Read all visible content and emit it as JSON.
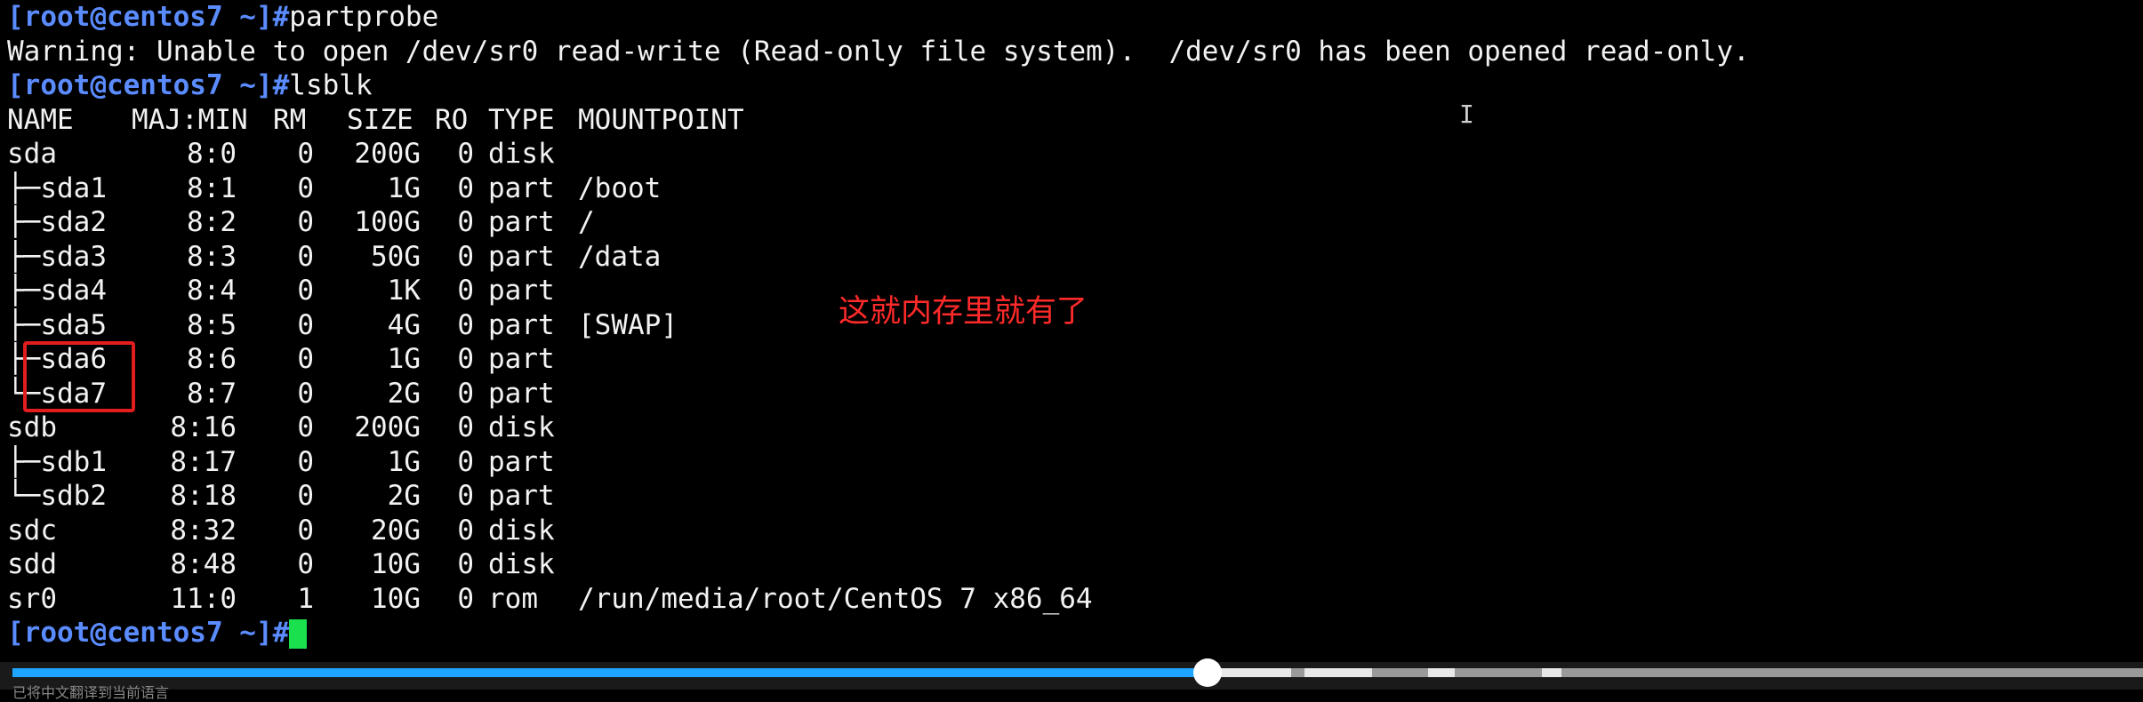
{
  "terminal": {
    "prompt": "[root@centos7 ~]#",
    "cmd1": "partprobe",
    "warning": "Warning: Unable to open /dev/sr0 read-write (Read-only file system).  /dev/sr0 has been opened read-only.",
    "cmd2": "lsblk",
    "header": {
      "name": "NAME",
      "majmin": "MAJ:MIN",
      "rm": "RM",
      "size": "SIZE",
      "ro": "RO",
      "type": "TYPE",
      "mount": "MOUNTPOINT"
    },
    "rows": [
      {
        "name": "sda",
        "majmin": "8:0",
        "rm": "0",
        "size": "200G",
        "ro": "0",
        "type": "disk",
        "mount": ""
      },
      {
        "name": "├─sda1",
        "majmin": "8:1",
        "rm": "0",
        "size": "1G",
        "ro": "0",
        "type": "part",
        "mount": "/boot"
      },
      {
        "name": "├─sda2",
        "majmin": "8:2",
        "rm": "0",
        "size": "100G",
        "ro": "0",
        "type": "part",
        "mount": "/"
      },
      {
        "name": "├─sda3",
        "majmin": "8:3",
        "rm": "0",
        "size": "50G",
        "ro": "0",
        "type": "part",
        "mount": "/data"
      },
      {
        "name": "├─sda4",
        "majmin": "8:4",
        "rm": "0",
        "size": "1K",
        "ro": "0",
        "type": "part",
        "mount": ""
      },
      {
        "name": "├─sda5",
        "majmin": "8:5",
        "rm": "0",
        "size": "4G",
        "ro": "0",
        "type": "part",
        "mount": "[SWAP]"
      },
      {
        "name": "├─sda6",
        "majmin": "8:6",
        "rm": "0",
        "size": "1G",
        "ro": "0",
        "type": "part",
        "mount": ""
      },
      {
        "name": "└─sda7",
        "majmin": "8:7",
        "rm": "0",
        "size": "2G",
        "ro": "0",
        "type": "part",
        "mount": ""
      },
      {
        "name": "sdb",
        "majmin": "8:16",
        "rm": "0",
        "size": "200G",
        "ro": "0",
        "type": "disk",
        "mount": ""
      },
      {
        "name": "├─sdb1",
        "majmin": "8:17",
        "rm": "0",
        "size": "1G",
        "ro": "0",
        "type": "part",
        "mount": ""
      },
      {
        "name": "└─sdb2",
        "majmin": "8:18",
        "rm": "0",
        "size": "2G",
        "ro": "0",
        "type": "part",
        "mount": ""
      },
      {
        "name": "sdc",
        "majmin": "8:32",
        "rm": "0",
        "size": "20G",
        "ro": "0",
        "type": "disk",
        "mount": ""
      },
      {
        "name": "sdd",
        "majmin": "8:48",
        "rm": "0",
        "size": "10G",
        "ro": "0",
        "type": "disk",
        "mount": ""
      },
      {
        "name": "sr0",
        "majmin": "11:0",
        "rm": "1",
        "size": "10G",
        "ro": "0",
        "type": "rom",
        "mount": "/run/media/root/CentOS 7 x86_64"
      }
    ]
  },
  "annotation": {
    "text": "这就内存里就有了",
    "color": "#ff2a2a"
  },
  "video": {
    "progress": 0.561,
    "accent": "#1ea6ff",
    "subtitle": "已将中文翻译到当前语言"
  },
  "icons": {
    "cursor": "text-cursor-icon"
  }
}
